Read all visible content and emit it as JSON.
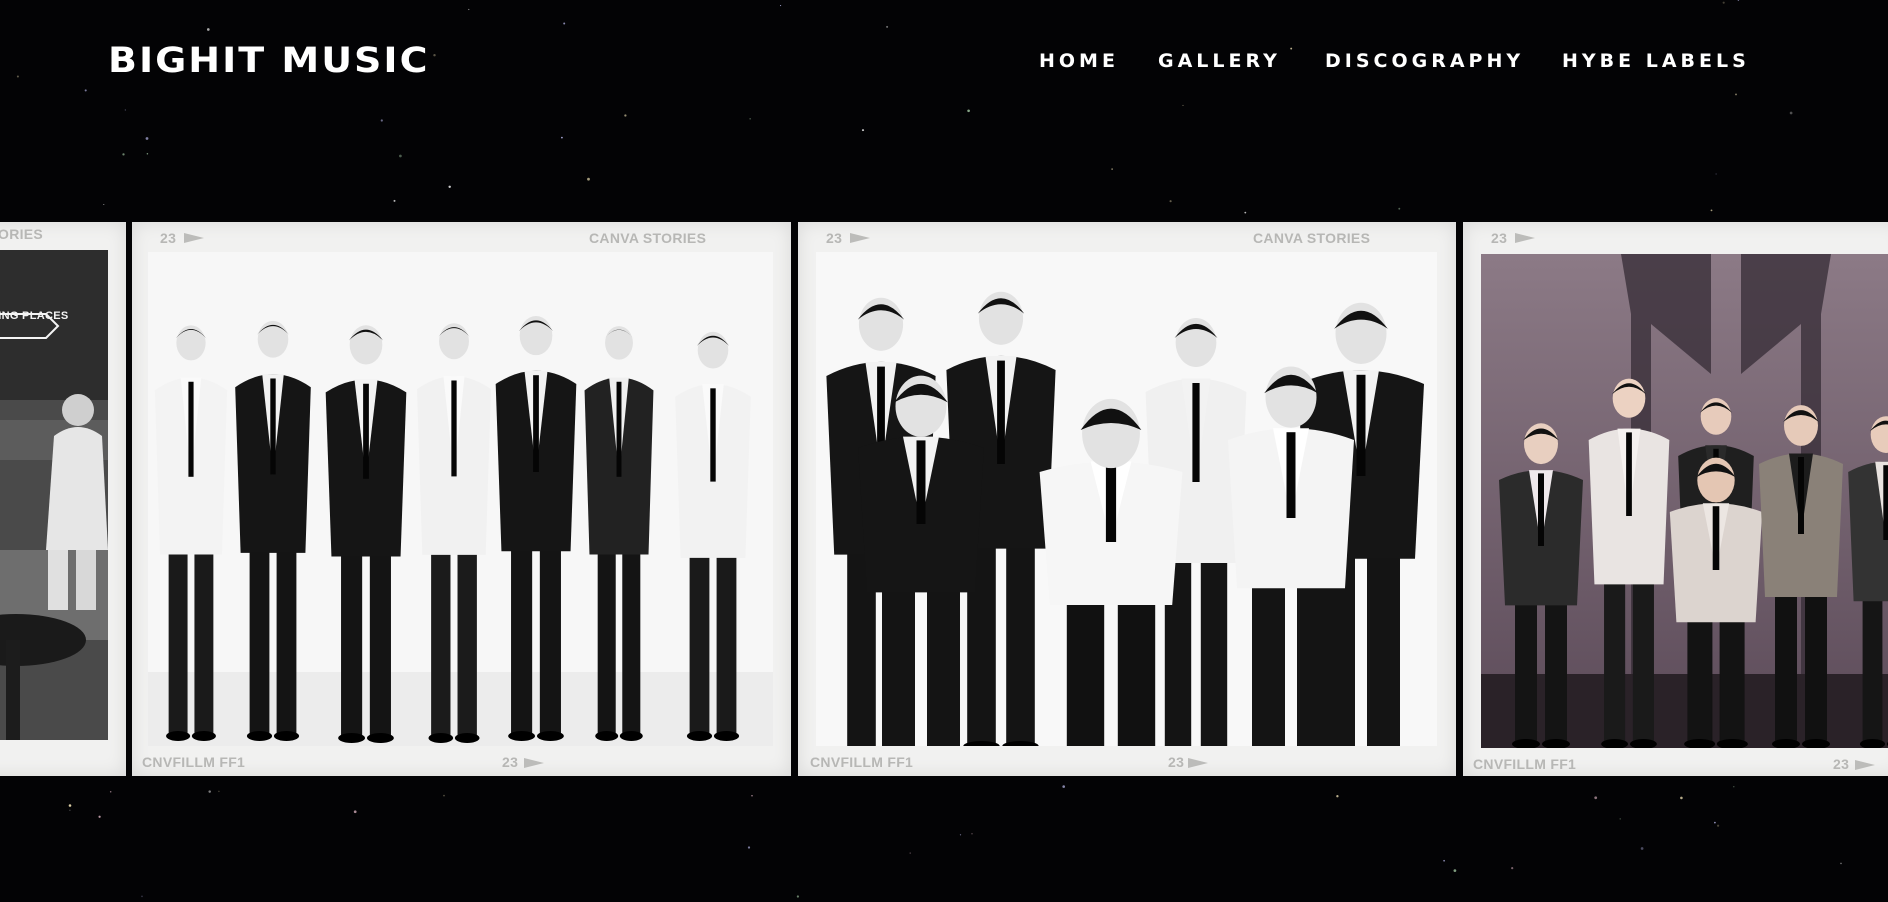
{
  "header": {
    "brand": "BIGHIT MUSIC",
    "nav": [
      {
        "label": "HOME"
      },
      {
        "label": "GALLERY"
      },
      {
        "label": "DISCOGRAPHY"
      },
      {
        "label": "HYBE LABELS"
      }
    ]
  },
  "gallery": {
    "frames": [
      {
        "top_left": "",
        "top_right": "ORIES",
        "bottom_left": "",
        "bottom_right": "",
        "sign_text": "DING PLACES",
        "photo": "lounge"
      },
      {
        "top_left": "23",
        "top_right": "CANVA STORIES",
        "bottom_left": "CNVFILLM FF1",
        "bottom_right": "23",
        "photo": "line-up"
      },
      {
        "top_left": "23",
        "top_right": "CANVA STORIES",
        "bottom_left": "CNVFILLM FF1",
        "bottom_right": "23",
        "photo": "group-huddle"
      },
      {
        "top_left": "23",
        "top_right": "",
        "bottom_left": "CNVFILLM FF1",
        "bottom_right": "23",
        "photo": "stage-color"
      }
    ]
  },
  "colors": {
    "background": "#030305",
    "frame": "#f1f1f0",
    "film_text": "#b7b7b5",
    "nav_text": "#ffffff"
  }
}
